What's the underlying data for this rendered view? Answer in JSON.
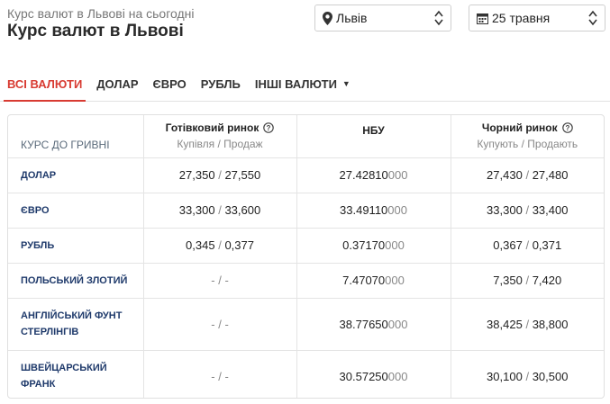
{
  "header": {
    "subtitle": "Курс валют в Львові на сьогодні",
    "title": "Курс валют в Львові"
  },
  "city_select": {
    "value": "Львів"
  },
  "date_select": {
    "value": "25 травня"
  },
  "tabs": [
    {
      "label": "ВСІ ВАЛЮТИ",
      "active": true
    },
    {
      "label": "ДОЛАР"
    },
    {
      "label": "ЄВРО"
    },
    {
      "label": "РУБЛЬ"
    },
    {
      "label": "ІНШІ ВАЛЮТИ",
      "caret": "▼"
    }
  ],
  "table": {
    "corner_label": "КУРС ДО ГРИВНІ",
    "columns": [
      {
        "title": "Готівковий ринок",
        "subtitle": "Купівля / Продаж"
      },
      {
        "title": "НБУ",
        "subtitle": ""
      },
      {
        "title": "Чорний ринок",
        "subtitle": "Купують / Продають"
      }
    ],
    "rows": [
      {
        "name": "ДОЛАР",
        "cash_buy": "27,350",
        "cash_sell": "27,550",
        "nbu_main": "27.42810",
        "nbu_tail": "000",
        "black_buy": "27,430",
        "black_sell": "27,480"
      },
      {
        "name": "ЄВРО",
        "cash_buy": "33,300",
        "cash_sell": "33,600",
        "nbu_main": "33.49110",
        "nbu_tail": "000",
        "black_buy": "33,300",
        "black_sell": "33,400"
      },
      {
        "name": "РУБЛЬ",
        "cash_buy": "0,345",
        "cash_sell": "0,377",
        "nbu_main": "0.37170",
        "nbu_tail": "000",
        "black_buy": "0,367",
        "black_sell": "0,371"
      },
      {
        "name": "ПОЛЬСЬКИЙ ЗЛОТИЙ",
        "cash_buy": "-",
        "cash_sell": "-",
        "nbu_main": "7.47070",
        "nbu_tail": "000",
        "black_buy": "7,350",
        "black_sell": "7,420"
      },
      {
        "name": "АНГЛІЙСЬКИЙ ФУНТ СТЕРЛІНГІВ",
        "cash_buy": "-",
        "cash_sell": "-",
        "nbu_main": "38.77650",
        "nbu_tail": "000",
        "black_buy": "38,425",
        "black_sell": "38,800"
      },
      {
        "name": "ШВЕЙЦАРСЬКИЙ ФРАНК",
        "cash_buy": "-",
        "cash_sell": "-",
        "nbu_main": "30.57250",
        "nbu_tail": "000",
        "black_buy": "30,100",
        "black_sell": "30,500"
      }
    ]
  },
  "colors": {
    "accent": "#d83b32",
    "currency_name": "#1f3a6b",
    "muted": "#888888"
  },
  "icons": {
    "city": "map-pin-icon",
    "date": "calendar-icon",
    "info": "info-circle-icon"
  }
}
